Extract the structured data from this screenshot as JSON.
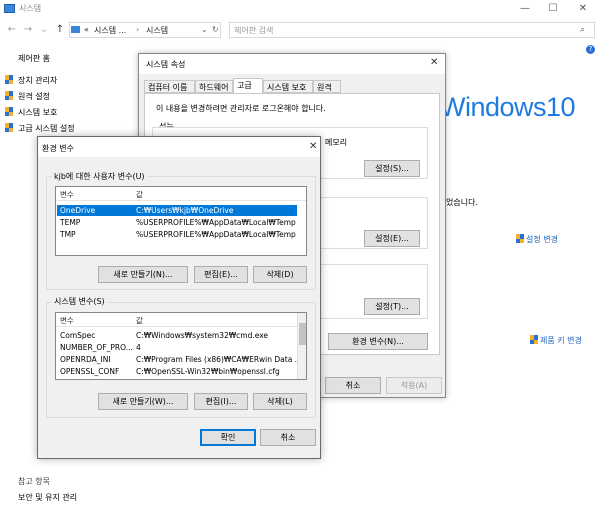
{
  "window": {
    "title": "시스템",
    "min": "—",
    "max": "☐",
    "close": "✕"
  },
  "address": {
    "back": "←",
    "forward": "→",
    "up": "↑",
    "crumb_prefix": "«",
    "crumb1": "시스템 ...",
    "sep": "›",
    "crumb2": "시스템",
    "dropdown": "⌄",
    "refresh": "↻",
    "search_placeholder": "제어판 검색"
  },
  "help": "?",
  "left_nav": {
    "home": "제어판 홈",
    "items": [
      "장치 관리자",
      "원격 설정",
      "시스템 보호",
      "고급 시스템 설정"
    ]
  },
  "right_panel": {
    "brand": "Windows10",
    "truncated_text": "었습니다.",
    "change_settings": "설정 변경",
    "change_key": "제품 키 변경"
  },
  "see_also": {
    "title": "참고 항목",
    "link": "보안 및 유지 관리"
  },
  "system_properties": {
    "title": "시스템 속성",
    "close": "✕",
    "tabs": [
      "컴퓨터 이름",
      "하드웨어",
      "고급",
      "시스템 보호",
      "원격"
    ],
    "active_tab": "고급",
    "info": "이 내용을 변경하려면 관리자로 로그온해야 합니다.",
    "performance_label": "성능",
    "memory_label": "메모리",
    "settings_btn1": "설정(S)...",
    "settings_btn2": "설정(E)...",
    "settings_btn3": "설정(T)...",
    "env_btn": "환경 변수(N)...",
    "cancel": "취소",
    "apply": "적용(A)"
  },
  "env_dialog": {
    "title": "환경 변수",
    "close": "✕",
    "user_section": "kjb에 대한 사용자 변수(U)",
    "col_var": "변수",
    "col_val": "값",
    "user_vars": [
      {
        "name": "OneDrive",
        "value": "C:₩Users₩kjb₩OneDrive"
      },
      {
        "name": "TEMP",
        "value": "%USERPROFILE%₩AppData₩Local₩Temp"
      },
      {
        "name": "TMP",
        "value": "%USERPROFILE%₩AppData₩Local₩Temp"
      }
    ],
    "user_buttons": {
      "new": "새로 만들기(N)...",
      "edit": "편집(E)...",
      "delete": "삭제(D)"
    },
    "system_section": "시스템 변수(S)",
    "system_vars": [
      {
        "name": "ComSpec",
        "value": "C:₩Windows₩system32₩cmd.exe"
      },
      {
        "name": "NUMBER_OF_PRO...",
        "value": "4"
      },
      {
        "name": "OPENRDA_INI",
        "value": "C:₩Program Files (x86)₩CA₩ERwin Data ..."
      },
      {
        "name": "OPENSSL_CONF",
        "value": "C:₩OpenSSL-Win32₩bin₩openssl.cfg"
      }
    ],
    "system_buttons": {
      "new": "새로 만들기(W)...",
      "edit": "편집(I)...",
      "delete": "삭제(L)"
    },
    "ok": "확인",
    "cancel": "취소"
  }
}
